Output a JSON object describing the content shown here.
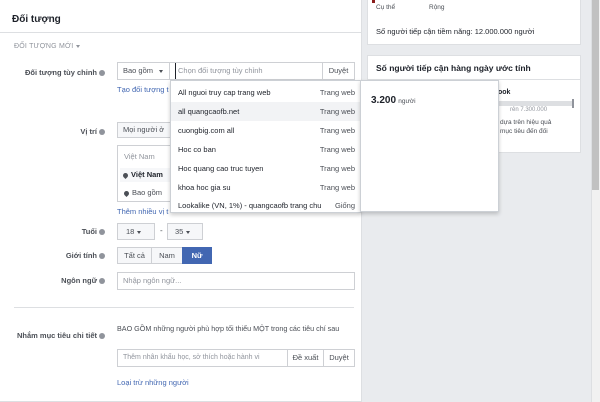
{
  "right_top": {
    "label_left": "Cụ thể",
    "label_right": "Rộng",
    "potential_reach": "Số người tiếp cận tiềm năng: 12.000.000 người"
  },
  "right_daily": {
    "title": "Số người tiếp cận hàng ngày ước tính",
    "book_partial": "ook",
    "range_partial": "rên 7.300.000",
    "desc_line1": "dựa trên hiệu quả",
    "desc_line2": "mục tiêu đến đối"
  },
  "audience": {
    "title": "Đối tượng",
    "new_audience": "ĐỐI TƯỢNG MỚI",
    "custom_label": "Đối tượng tùy chỉnh",
    "include_select": "Bao gồm",
    "custom_placeholder": "Chọn đối tượng tùy chỉnh",
    "browse": "Duyệt",
    "create_new": "Tạo đối tượng t",
    "location_label": "Vị trí",
    "location_select": "Mọi người ở",
    "country_header": "Việt Nam",
    "country_item": "Việt Nam",
    "include_item": "Bao gồm",
    "more_locations": "Thêm nhiều vị t",
    "age_label": "Tuổi",
    "age_min": "18",
    "age_max": "35",
    "age_dash": "-",
    "gender_label": "Giới tính",
    "gender_all": "Tất cả",
    "gender_male": "Nam",
    "gender_female": "Nữ",
    "language_label": "Ngôn ngữ",
    "language_placeholder": "Nhập ngôn ngữ...",
    "detailed_label": "Nhắm mục tiêu chi tiết",
    "detailed_desc": "BAO GỒM những người phù hợp tối thiểu MỘT trong các tiêu chí sau",
    "detailed_placeholder": "Thêm nhân khẩu học, sở thích hoặc hành vi",
    "suggest": "Đề xuất",
    "browse2": "Duyệt",
    "exclude": "Loại trừ những người"
  },
  "dropdown": {
    "items": [
      {
        "name": "All nguoi truy cap trang web",
        "type": "Trang web"
      },
      {
        "name": "all quangcaofb.net",
        "type": "Trang web"
      },
      {
        "name": "cuongbig.com all",
        "type": "Trang web"
      },
      {
        "name": "Hoc co ban",
        "type": "Trang web"
      },
      {
        "name": "Hoc quang cao truc tuyen",
        "type": "Trang web"
      },
      {
        "name": "khoa hoc gia su",
        "type": "Trang web"
      },
      {
        "name": "Lookalike (VN, 1%) - quangcaofb trang chu",
        "type": "Giống"
      }
    ]
  },
  "tooltip": {
    "count": "3.200",
    "unit": "người"
  },
  "colors": {
    "accent": "#4267b2",
    "background": "#e9ebee"
  }
}
